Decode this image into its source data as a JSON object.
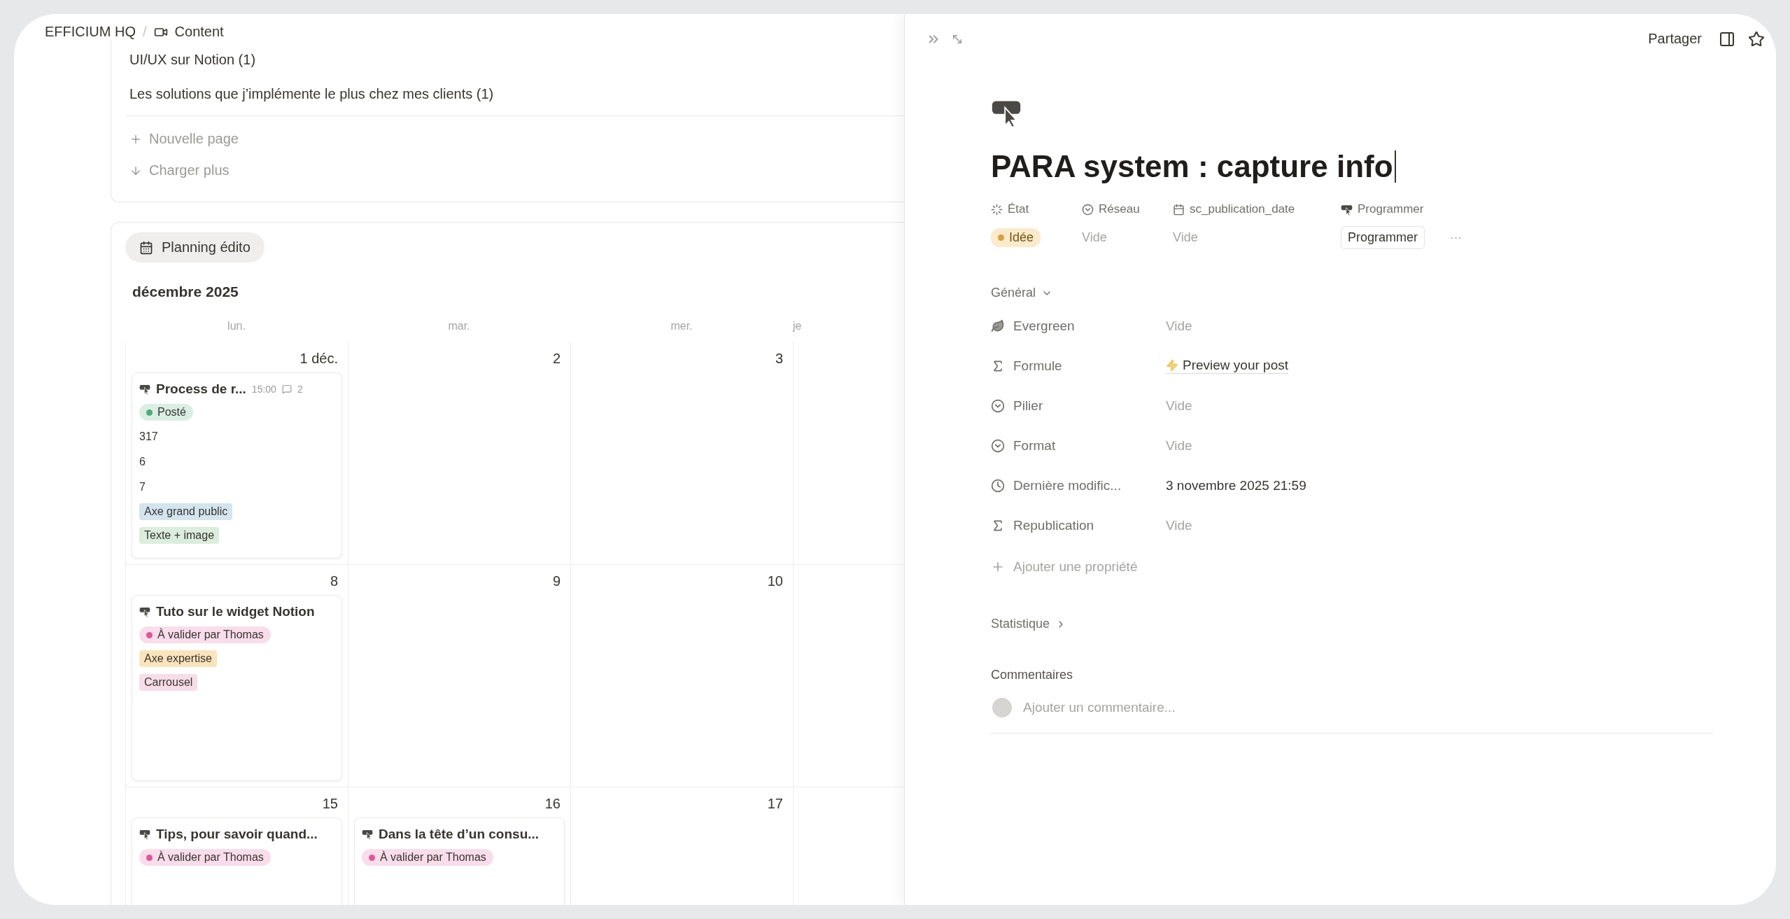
{
  "breadcrumb": {
    "workspace": "EFFICIUM HQ",
    "separator": "/",
    "page": "Content"
  },
  "list": {
    "groups": [
      "UI/UX sur Notion (1)",
      "Les solutions que j’implémente le plus chez mes clients (1)"
    ],
    "actions": [
      {
        "kind": "new",
        "label": "Nouvelle page"
      },
      {
        "kind": "more",
        "label": "Charger plus"
      }
    ]
  },
  "calendar": {
    "view_tab": "Planning édito",
    "month": "décembre 2025",
    "weekdays": [
      "lun.",
      "mar.",
      "mer.",
      "je"
    ],
    "weeks": [
      {
        "days": [
          {
            "label": "1 déc.",
            "cards": [
              {
                "title": "Process de r...",
                "time": "15:00",
                "comments": "2",
                "status": {
                  "label": "Posté",
                  "color": "#4dab7a"
                },
                "lines": [
                  "317",
                  "6",
                  "7"
                ],
                "tags": [
                  {
                    "label": "Axe grand public",
                    "color": "#d3e5ef"
                  },
                  {
                    "label": "Texte + image",
                    "color": "#dbeddb"
                  }
                ]
              }
            ]
          },
          {
            "label": "2"
          },
          {
            "label": "3"
          }
        ]
      },
      {
        "days": [
          {
            "label": "8",
            "cards": [
              {
                "title": "Tuto sur le widget Notion",
                "status": {
                  "label": "À valider par Thomas",
                  "color": "#e0569c"
                },
                "tags": [
                  {
                    "label": "Axe expertise",
                    "color": "#fbe4bc"
                  },
                  {
                    "label": "Carrousel",
                    "color": "#f7dde8"
                  }
                ]
              }
            ]
          },
          {
            "label": "9"
          },
          {
            "label": "10"
          }
        ]
      },
      {
        "days": [
          {
            "label": "15",
            "cards": [
              {
                "title": "Tips, pour savoir quand...",
                "status": {
                  "label": "À valider par Thomas",
                  "color": "#e0569c"
                }
              }
            ]
          },
          {
            "label": "16",
            "cards": [
              {
                "title": "Dans la tête d’un consu...",
                "status": {
                  "label": "À valider par Thomas",
                  "color": "#e0569c"
                }
              }
            ]
          },
          {
            "label": "17"
          }
        ]
      }
    ]
  },
  "peek": {
    "share": "Partager",
    "title": "PARA system : capture info",
    "header_properties": [
      {
        "kind": "status",
        "name": "État",
        "value": "Idée",
        "color": "#d9a13b"
      },
      {
        "kind": "select",
        "name": "Réseau",
        "value": "Vide"
      },
      {
        "kind": "date",
        "name": "sc_publication_date",
        "value": "Vide"
      },
      {
        "kind": "button",
        "name": "Programmer",
        "value": "Programmer"
      }
    ],
    "more": "···",
    "sections": [
      {
        "title": "Général",
        "expanded": true,
        "properties": [
          {
            "kind": "leaf",
            "name": "Evergreen",
            "value": "Vide",
            "empty": true
          },
          {
            "kind": "formula",
            "name": "Formule",
            "value": "Preview your post",
            "empty": false
          },
          {
            "kind": "select",
            "name": "Pilier",
            "value": "Vide",
            "empty": true
          },
          {
            "kind": "select",
            "name": "Format",
            "value": "Vide",
            "empty": true
          },
          {
            "kind": "clock",
            "name": "Dernière modific...",
            "value": "3 novembre 2025 21:59",
            "empty": false
          },
          {
            "kind": "formula",
            "name": "Republication",
            "value": "Vide",
            "empty": true
          }
        ],
        "add_label": "Ajouter une propriété"
      },
      {
        "title": "Statistique",
        "expanded": false
      }
    ],
    "comments": {
      "heading": "Commentaires",
      "placeholder": "Ajouter un commentaire..."
    }
  }
}
